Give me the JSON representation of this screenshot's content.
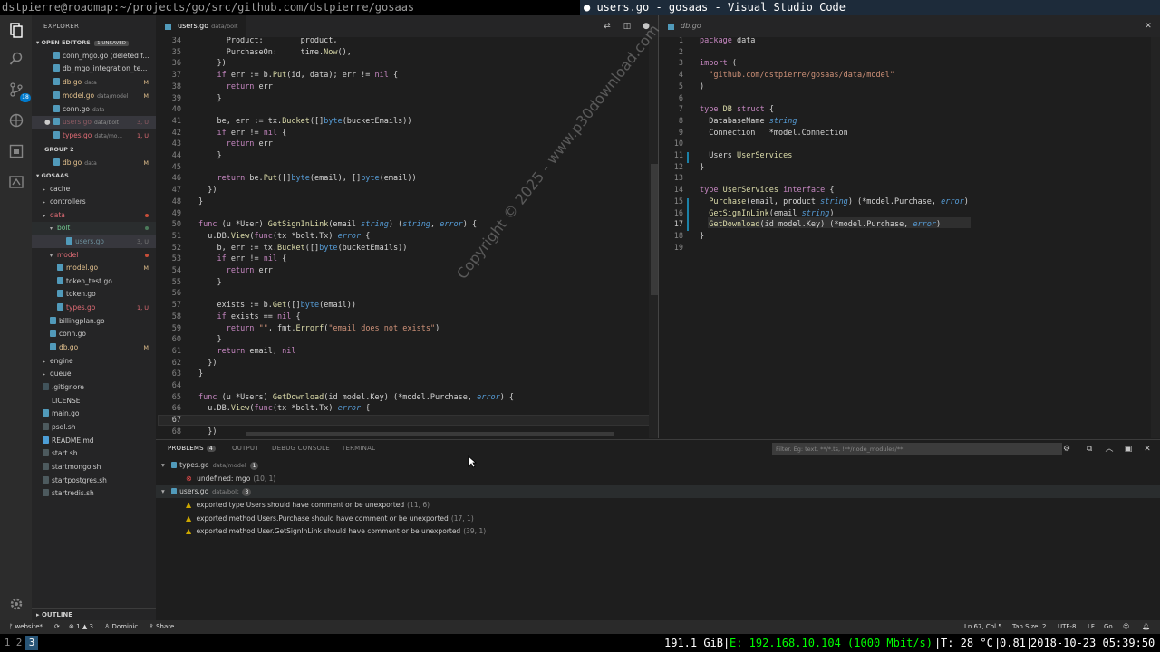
{
  "title_bar": {
    "terminal_title": "dstpierre@roadmap:~/projects/go/src/github.com/dstpierre/gosaas",
    "vscode_title": "users.go - gosaas - Visual Studio Code"
  },
  "activity_bar": {
    "scm_badge": "18"
  },
  "sidebar": {
    "title": "EXPLORER",
    "open_editors_label": "OPEN EDITORS",
    "unsaved_badge": "1 UNSAVED",
    "open_editors": [
      {
        "name": "conn_mgo.go (deleted f...",
        "path": "",
        "status": ""
      },
      {
        "name": "db_mgo_integration_te...",
        "path": "",
        "status": ""
      },
      {
        "name": "db.go",
        "path": "data",
        "status": "M"
      },
      {
        "name": "model.go",
        "path": "data/model",
        "status": "M"
      },
      {
        "name": "conn.go",
        "path": "data",
        "status": ""
      },
      {
        "name": "users.go",
        "path": "data/bolt",
        "status": "3, U"
      },
      {
        "name": "types.go",
        "path": "data/mo...",
        "status": "1, U"
      }
    ],
    "group2_label": "GROUP 2",
    "group2_items": [
      {
        "name": "db.go",
        "path": "data",
        "status": "M"
      }
    ],
    "project_label": "GOSAAS",
    "tree": [
      {
        "name": "cache",
        "type": "folder",
        "status": ""
      },
      {
        "name": "controllers",
        "type": "folder",
        "status": ""
      },
      {
        "name": "data",
        "type": "folder-open",
        "status": "dot"
      },
      {
        "name": "bolt",
        "type": "folder-open",
        "status": "dot"
      },
      {
        "name": "users.go",
        "type": "file",
        "status": "3, U"
      },
      {
        "name": "model",
        "type": "folder-open",
        "status": "dot"
      },
      {
        "name": "model.go",
        "type": "file",
        "status": "M"
      },
      {
        "name": "token_test.go",
        "type": "file",
        "status": ""
      },
      {
        "name": "token.go",
        "type": "file",
        "status": ""
      },
      {
        "name": "types.go",
        "type": "file",
        "status": "1, U"
      },
      {
        "name": "billingplan.go",
        "type": "file",
        "status": ""
      },
      {
        "name": "conn.go",
        "type": "file",
        "status": ""
      },
      {
        "name": "db.go",
        "type": "file",
        "status": "M"
      },
      {
        "name": "engine",
        "type": "folder",
        "status": ""
      },
      {
        "name": "queue",
        "type": "folder",
        "status": ""
      },
      {
        "name": ".gitignore",
        "type": "file",
        "status": ""
      },
      {
        "name": "LICENSE",
        "type": "file",
        "status": ""
      },
      {
        "name": "main.go",
        "type": "file",
        "status": ""
      },
      {
        "name": "psql.sh",
        "type": "file",
        "status": ""
      },
      {
        "name": "README.md",
        "type": "file",
        "status": ""
      },
      {
        "name": "start.sh",
        "type": "file",
        "status": ""
      },
      {
        "name": "startmongo.sh",
        "type": "file",
        "status": ""
      },
      {
        "name": "startpostgres.sh",
        "type": "file",
        "status": ""
      },
      {
        "name": "startredis.sh",
        "type": "file",
        "status": ""
      }
    ],
    "outline_label": "OUTLINE"
  },
  "editor_left": {
    "tab_name": "users.go",
    "tab_path": "data/bolt",
    "lines": [
      {
        "n": "34",
        "code": "      Product:        product,"
      },
      {
        "n": "35",
        "code": "      PurchaseOn:     time.Now(),"
      },
      {
        "n": "36",
        "code": "    })"
      },
      {
        "n": "37",
        "code": "    if err := b.Put(id, data); err != nil {"
      },
      {
        "n": "38",
        "code": "      return err"
      },
      {
        "n": "39",
        "code": "    }"
      },
      {
        "n": "40",
        "code": ""
      },
      {
        "n": "41",
        "code": "    be, err := tx.Bucket([]byte(bucketEmails))"
      },
      {
        "n": "42",
        "code": "    if err != nil {"
      },
      {
        "n": "43",
        "code": "      return err"
      },
      {
        "n": "44",
        "code": "    }"
      },
      {
        "n": "45",
        "code": ""
      },
      {
        "n": "46",
        "code": "    return be.Put([]byte(email), []byte(email))"
      },
      {
        "n": "47",
        "code": "  })"
      },
      {
        "n": "48",
        "code": "}"
      },
      {
        "n": "49",
        "code": ""
      },
      {
        "n": "50",
        "code": "func (u *User) GetSignInLink(email string) (string, error) {"
      },
      {
        "n": "51",
        "code": "  u.DB.View(func(tx *bolt.Tx) error {"
      },
      {
        "n": "52",
        "code": "    b, err := tx.Bucket([]byte(bucketEmails))"
      },
      {
        "n": "53",
        "code": "    if err != nil {"
      },
      {
        "n": "54",
        "code": "      return err"
      },
      {
        "n": "55",
        "code": "    }"
      },
      {
        "n": "56",
        "code": ""
      },
      {
        "n": "57",
        "code": "    exists := b.Get([]byte(email))"
      },
      {
        "n": "58",
        "code": "    if exists == nil {"
      },
      {
        "n": "59",
        "code": "      return \"\", fmt.Errorf(\"email does not exists\")"
      },
      {
        "n": "60",
        "code": "    }"
      },
      {
        "n": "61",
        "code": "    return email, nil"
      },
      {
        "n": "62",
        "code": "  })"
      },
      {
        "n": "63",
        "code": "}"
      },
      {
        "n": "64",
        "code": ""
      },
      {
        "n": "65",
        "code": "func (u *Users) GetDownload(id model.Key) (*model.Purchase, error) {"
      },
      {
        "n": "66",
        "code": "  u.DB.View(func(tx *bolt.Tx) error {"
      },
      {
        "n": "67",
        "code": ""
      },
      {
        "n": "68",
        "code": "  })"
      }
    ]
  },
  "editor_right": {
    "tab_name": "db.go",
    "lines": [
      {
        "n": "1",
        "code": "package data"
      },
      {
        "n": "2",
        "code": ""
      },
      {
        "n": "3",
        "code": "import ("
      },
      {
        "n": "4",
        "code": "  \"github.com/dstpierre/gosaas/data/model\""
      },
      {
        "n": "5",
        "code": ")"
      },
      {
        "n": "6",
        "code": ""
      },
      {
        "n": "7",
        "code": "type DB struct {"
      },
      {
        "n": "8",
        "code": "  DatabaseName string"
      },
      {
        "n": "9",
        "code": "  Connection   *model.Connection"
      },
      {
        "n": "10",
        "code": ""
      },
      {
        "n": "11",
        "code": "  Users UserServices"
      },
      {
        "n": "12",
        "code": "}"
      },
      {
        "n": "13",
        "code": ""
      },
      {
        "n": "14",
        "code": "type UserServices interface {"
      },
      {
        "n": "15",
        "code": "  Purchase(email, product string) (*model.Purchase, error)"
      },
      {
        "n": "16",
        "code": "  GetSignInLink(email string)"
      },
      {
        "n": "17",
        "code": "  GetDownload(id model.Key) (*model.Purchase, error)"
      },
      {
        "n": "18",
        "code": "}"
      },
      {
        "n": "19",
        "code": ""
      }
    ]
  },
  "watermark": "Copyright © 2025 - www.p30download.com",
  "panel": {
    "tabs": [
      "PROBLEMS",
      "OUTPUT",
      "DEBUG CONSOLE",
      "TERMINAL"
    ],
    "problems_count": "4",
    "filter_placeholder": "Filter. Eg: text, **/*.ts, !**/node_modules/**",
    "groups": [
      {
        "file": "types.go",
        "path": "data/model",
        "count": "1",
        "items": [
          {
            "kind": "error",
            "text": "undefined: mgo",
            "loc": "(10, 1)"
          }
        ]
      },
      {
        "file": "users.go",
        "path": "data/bolt",
        "count": "3",
        "items": [
          {
            "kind": "warning",
            "text": "exported type Users should have comment or be unexported",
            "loc": "(11, 6)"
          },
          {
            "kind": "warning",
            "text": "exported method Users.Purchase should have comment or be unexported",
            "loc": "(17, 1)"
          },
          {
            "kind": "warning",
            "text": "exported method User.GetSignInLink should have comment or be unexported",
            "loc": "(39, 1)"
          }
        ]
      }
    ]
  },
  "status_bar": {
    "branch": "website*",
    "errors": "1",
    "warnings": "3",
    "user": "Dominic",
    "share": "Share",
    "position": "Ln 67, Col 5",
    "tab_size": "Tab Size: 2",
    "encoding": "UTF-8",
    "eol": "LF",
    "language": "Go"
  },
  "system_bar": {
    "workspaces": [
      "1",
      "2",
      "3"
    ],
    "active_workspace": "3",
    "disk": "191.1 GiB",
    "network": "E: 192.168.10.104 (1000 Mbit/s)",
    "temp": "T: 28 °C",
    "load": "0.81",
    "datetime": "2018-10-23 05:39:50"
  }
}
